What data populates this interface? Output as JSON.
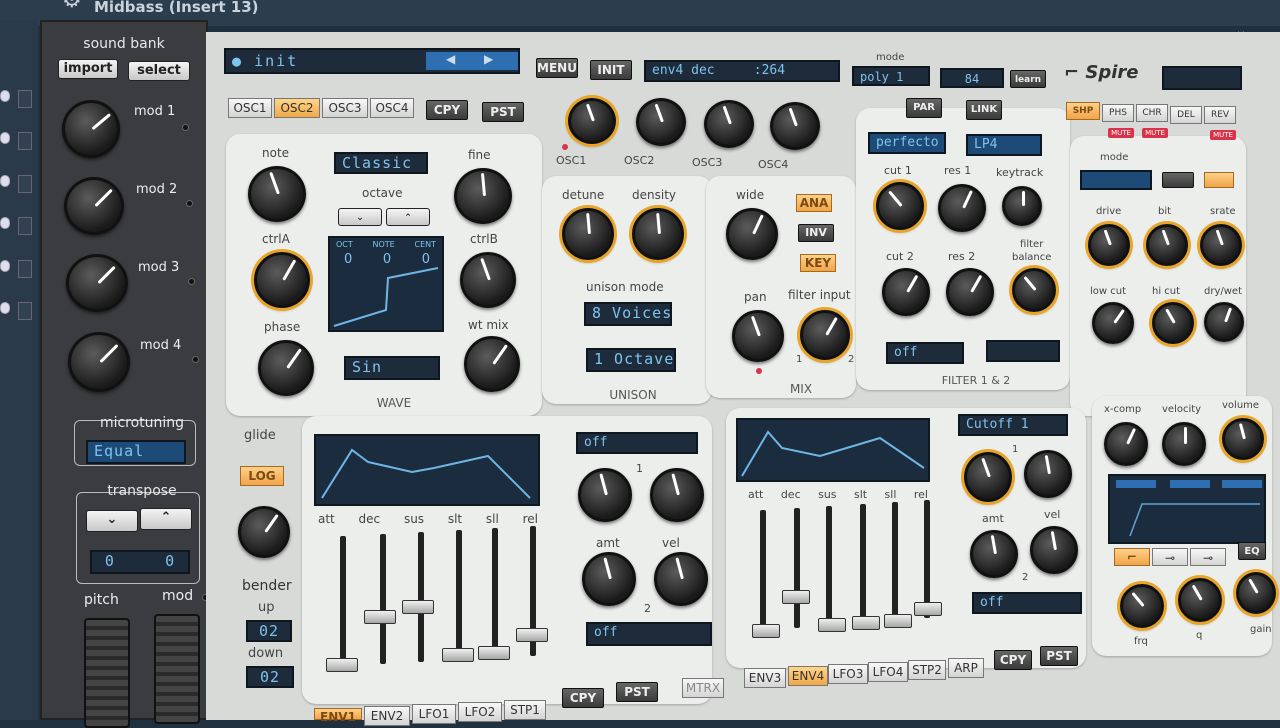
{
  "window": {
    "title": "Midbass (Insert 13)",
    "controls": "▪ ◂ ▸ − ▫ ×"
  },
  "left": {
    "sound_bank": "sound bank",
    "import": "import",
    "select": "select",
    "mods": [
      "mod 1",
      "mod 2",
      "mod 3",
      "mod 4"
    ],
    "microtuning": "microtuning",
    "microtuning_value": "Equal",
    "transpose": "transpose",
    "transpose_down": "⌄",
    "transpose_up": "⌃",
    "transpose_a": "0",
    "transpose_b": "0",
    "glide": "glide",
    "log": "LOG",
    "bender": "bender",
    "up": "up",
    "up_val": "02",
    "down": "down",
    "down_val": "02",
    "pitch": "pitch",
    "mod": "mod"
  },
  "top": {
    "patch": "init",
    "menu": "MENU",
    "init": "INIT",
    "display": "env4 dec",
    "display_value": ":264",
    "mode_label": "mode",
    "mode_value": "poly 1",
    "voices_value": "84",
    "learn": "learn",
    "brand": "Spire"
  },
  "osc": {
    "tabs": [
      "OSC1",
      "OSC2",
      "OSC3",
      "OSC4"
    ],
    "active_tab": 1,
    "cpy": "CPY",
    "pst": "PST",
    "knob_labels": [
      "OSC1",
      "OSC2",
      "OSC3",
      "OSC4"
    ],
    "note": "note",
    "fine": "fine",
    "mode": "Classic",
    "octave": "octave",
    "ctrlA": "ctrlA",
    "ctrlB": "ctrlB",
    "phase": "phase",
    "wt_mix": "wt mix",
    "display_heads": [
      "OCT",
      "NOTE",
      "CENT"
    ],
    "display_vals": [
      "0",
      "0",
      "0"
    ],
    "wave": "Sin",
    "wave_label": "WAVE"
  },
  "unison": {
    "detune": "detune",
    "density": "density",
    "mode_label": "unison mode",
    "voices": "8 Voices",
    "range": "1 Octave",
    "label": "UNISON"
  },
  "mix": {
    "wide": "wide",
    "ana": "ANA",
    "inv": "INV",
    "key": "KEY",
    "pan": "pan",
    "filter_input": "filter input",
    "in1": "1",
    "in2": "2",
    "label": "MIX"
  },
  "filter": {
    "par": "PAR",
    "link": "LINK",
    "type1": "perfecto",
    "type2": "LP4",
    "cut1": "cut 1",
    "res1": "res 1",
    "keytrack": "keytrack",
    "cut2": "cut 2",
    "res2": "res 2",
    "filter_balance": "filter\nbalance",
    "slot_a": "off",
    "label": "FILTER 1 & 2"
  },
  "fx": {
    "tabs": [
      "SHP",
      "PHS",
      "CHR",
      "DEL",
      "REV"
    ],
    "mute": "MUTE",
    "mode": "mode",
    "drive": "drive",
    "bit": "bit",
    "srate": "srate",
    "low_cut": "low cut",
    "hi_cut": "hi cut",
    "dry_wet": "dry/wet",
    "xcomp": "x-comp",
    "velocity": "velocity",
    "volume": "volume",
    "eq": "EQ",
    "frq": "frq",
    "q": "q",
    "gain": "gain"
  },
  "env1": {
    "labels": [
      "att",
      "dec",
      "sus",
      "slt",
      "sll",
      "rel"
    ],
    "dest": "off",
    "amt": "amt",
    "vel": "vel",
    "n1": "1",
    "n2": "2",
    "dest2": "off",
    "tabs": [
      "ENV1",
      "ENV2",
      "LFO1",
      "LFO2",
      "STP1"
    ],
    "cpy": "CPY",
    "pst": "PST",
    "mtrx": "MTRX"
  },
  "env2": {
    "labels": [
      "att",
      "dec",
      "sus",
      "slt",
      "sll",
      "rel"
    ],
    "dest": "Cutoff 1",
    "amt": "amt",
    "vel": "vel",
    "n1": "1",
    "n2": "2",
    "dest2": "off",
    "tabs": [
      "ENV3",
      "ENV4",
      "LFO3",
      "LFO4",
      "STP2",
      "ARP"
    ],
    "cpy": "CPY",
    "pst": "PST"
  },
  "colors": {
    "accent": "#f0a848",
    "lcd": "#1d2b3a",
    "lcd_text": "#7ec3ee",
    "panel": "#d8dad8"
  }
}
